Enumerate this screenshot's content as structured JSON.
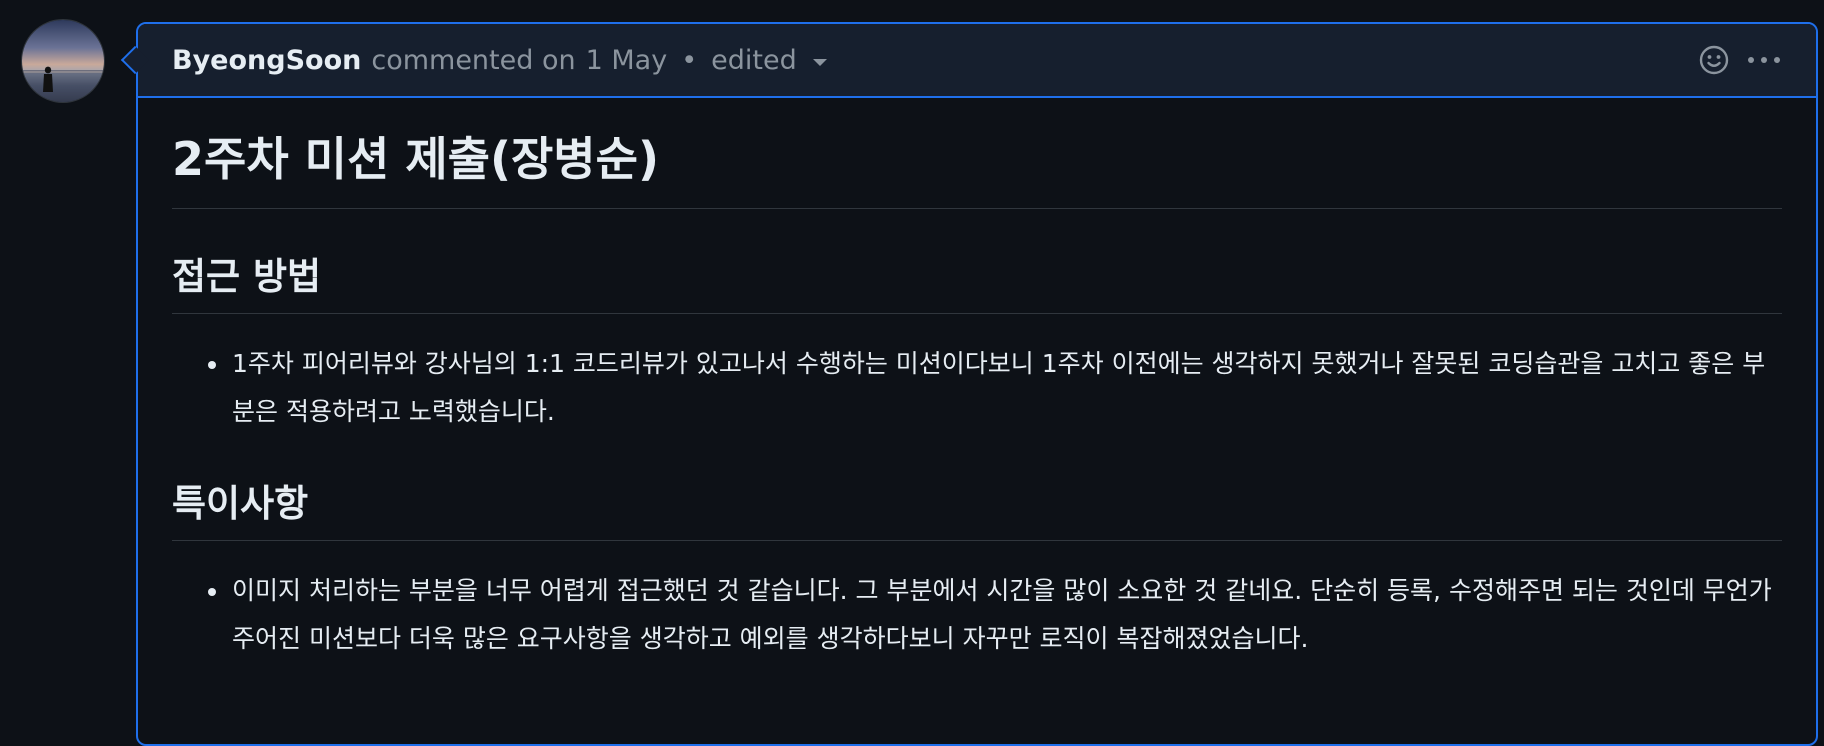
{
  "comment": {
    "author": "ByeongSoon",
    "action": "commented on",
    "date": "1 May",
    "separator": "•",
    "edited_label": "edited",
    "header_icons": [
      "smiley-icon",
      "kebab-menu-icon"
    ]
  },
  "body": {
    "title": "2주차 미션 제출(장병순)",
    "sections": [
      {
        "heading": "접근 방법",
        "items": [
          "1주차 피어리뷰와 강사님의 1:1 코드리뷰가 있고나서 수행하는 미션이다보니 1주차 이전에는 생각하지 못했거나 잘못된 코딩습관을 고치고 좋은 부분은 적용하려고 노력했습니다."
        ]
      },
      {
        "heading": "특이사항",
        "items": [
          "이미지 처리하는 부분을 너무 어렵게 접근했던 것 같습니다. 그 부분에서 시간을 많이 소요한 것 같네요. 단순히 등록, 수정해주면 되는 것인데 무언가 주어진 미션보다 더욱 많은 요구사항을 생각하고 예외를 생각하다보니 자꾸만 로직이 복잡해졌었습니다."
        ]
      }
    ]
  },
  "colors": {
    "background": "#0d1117",
    "header_background": "#161f2e",
    "accent_border": "#1f6feb",
    "text_primary": "#e6edf3",
    "text_muted": "#8b949e"
  }
}
